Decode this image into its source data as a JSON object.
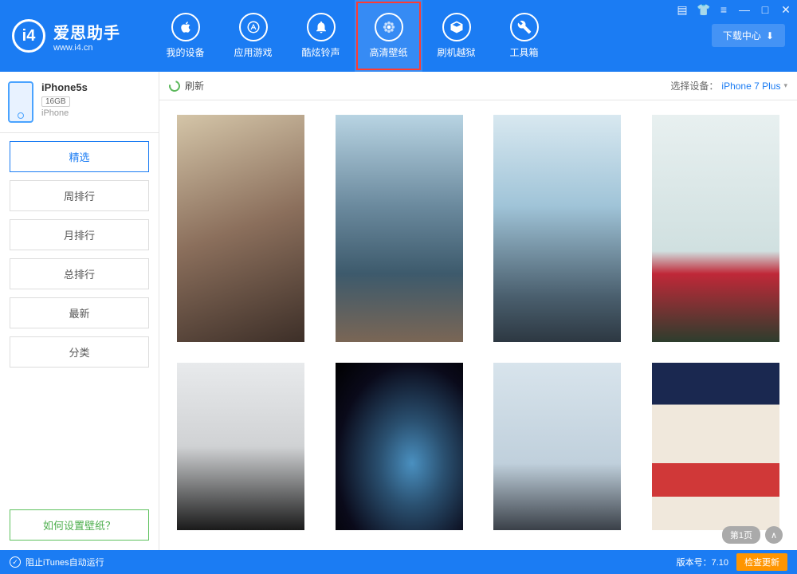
{
  "logo": {
    "mark": "i4",
    "title": "爱思助手",
    "url": "www.i4.cn"
  },
  "nav": [
    {
      "label": "我的设备"
    },
    {
      "label": "应用游戏"
    },
    {
      "label": "酷炫铃声"
    },
    {
      "label": "高清壁纸"
    },
    {
      "label": "刷机越狱"
    },
    {
      "label": "工具箱"
    }
  ],
  "download_center": "下载中心",
  "device": {
    "name": "iPhone5s",
    "storage": "16GB",
    "type": "iPhone"
  },
  "categories": [
    "精选",
    "周排行",
    "月排行",
    "总排行",
    "最新",
    "分类"
  ],
  "help_link": "如何设置壁纸？",
  "toolbar": {
    "refresh": "刷新",
    "device_select_label": "选择设备：",
    "device_select_value": "iPhone 7 Plus"
  },
  "pagination": {
    "current": "第1页"
  },
  "footer": {
    "itunes_block": "阻止iTunes自动运行",
    "version_label": "版本号：",
    "version": "7.10",
    "check_update": "检查更新"
  }
}
